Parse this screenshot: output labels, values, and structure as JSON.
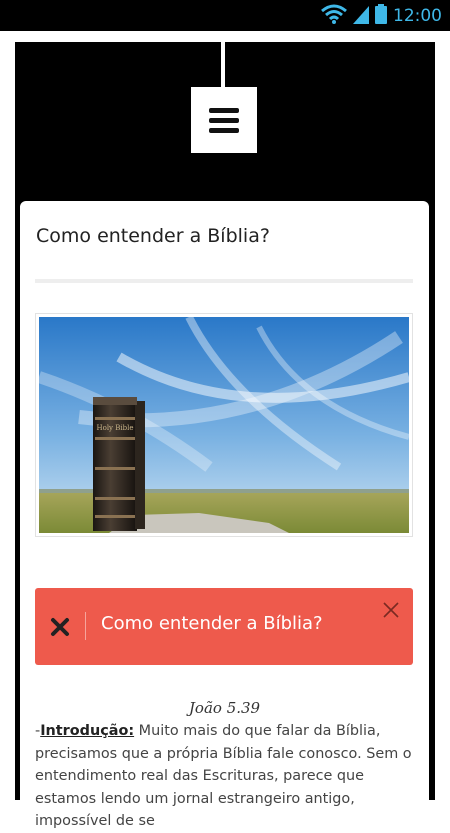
{
  "status_bar": {
    "time": "12:00",
    "icons": [
      "wifi-icon",
      "signal-icon",
      "battery-icon"
    ]
  },
  "menu": {
    "icon": "hamburger-icon"
  },
  "card": {
    "title": "Como entender a Bíblia?",
    "image": {
      "book_spine_text": "Holy Bible"
    }
  },
  "alert": {
    "text": "Como entender a Bíblia?",
    "color": "#ee5a4c",
    "icons": [
      "x-icon",
      "close-icon"
    ]
  },
  "content": {
    "verse": "João 5.39",
    "intro_prefix": "-",
    "intro_label": "Introdução:",
    "paragraph": " Muito mais do que falar da Bíblia, precisamos que a própria Bíblia fale conosco. Sem o entendimento real das Escrituras, parece que estamos lendo um jornal estrangeiro antigo, impossível de se"
  },
  "colors": {
    "status_time": "#3fb8e8",
    "frame": "#000000",
    "alert": "#ee5a4c"
  }
}
